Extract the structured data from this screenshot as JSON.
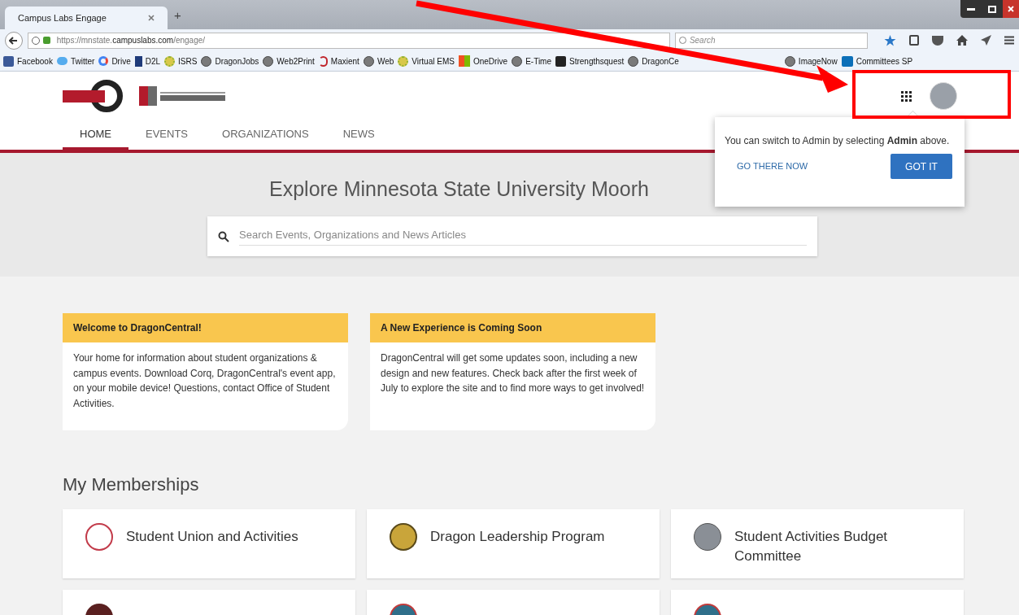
{
  "browser": {
    "tabs": [
      {
        "title": "Campus Labs Engage",
        "selected": true
      }
    ],
    "new_tab": "+",
    "url": "https://mnstate.**campuslabs.com**/engage/",
    "search": {
      "placeholder": "Search"
    },
    "bookmarks": [
      {
        "label": "Facebook",
        "kind": "facebook"
      },
      {
        "label": "Twitter",
        "kind": "twitter"
      },
      {
        "label": "Drive",
        "kind": "google"
      },
      {
        "label": "D2L",
        "kind": "bookmark"
      },
      {
        "label": "ISRS",
        "kind": "sun"
      },
      {
        "label": "DragonJobs",
        "kind": "globe"
      },
      {
        "label": "Web2Print",
        "kind": "globe"
      },
      {
        "label": "Maxient",
        "kind": "swoosh"
      },
      {
        "label": "Web",
        "kind": "globe"
      },
      {
        "label": "Virtual EMS",
        "kind": "sun"
      },
      {
        "label": "OneDrive",
        "kind": "tiles"
      },
      {
        "label": "E-Time",
        "kind": "globe"
      },
      {
        "label": "Strengthsquest",
        "kind": "letter"
      },
      {
        "label": "DragonCe",
        "kind": "globe"
      },
      {
        "label": "ImageNow",
        "kind": "globe"
      },
      {
        "label": "Committees SP",
        "kind": "sharepoint"
      }
    ]
  },
  "header": {
    "nav": [
      {
        "label": "HOME",
        "selected": true
      },
      {
        "label": "EVENTS",
        "selected": false
      },
      {
        "label": "ORGANIZATIONS",
        "selected": false
      },
      {
        "label": "NEWS",
        "selected": false
      }
    ]
  },
  "popover": {
    "message": "You can switch to Admin by selecting **Admin** above.",
    "link": "GO THERE NOW",
    "button": "GOT IT"
  },
  "hero": {
    "title": "Explore Minnesota State University Moorh",
    "search": {
      "placeholder": "Search Events, Organizations and News Articles"
    }
  },
  "notices": [
    {
      "title": "Welcome to DragonCentral!",
      "body": "Your home for information about student organizations & campus events. Download Corq, DragonCentral's event app, on your mobile device! Questions, contact Office of Student Activities."
    },
    {
      "title": "A New Experience is Coming Soon",
      "body": "DragonCentral will get some updates soon, including a new design and new features. Check back after the first week of July to explore the site and to find more ways to get involved!"
    }
  ],
  "memberships": {
    "title": "My Memberships",
    "items": [
      {
        "name": "Student Union and Activities",
        "kind": "seal"
      },
      {
        "name": "Dragon Leadership Program",
        "kind": "medal"
      },
      {
        "name": "Student Activities Budget Committee",
        "kind": "calculator"
      },
      {
        "kind": "group"
      },
      {
        "kind": "globe"
      },
      {
        "kind": "globe"
      }
    ]
  }
}
